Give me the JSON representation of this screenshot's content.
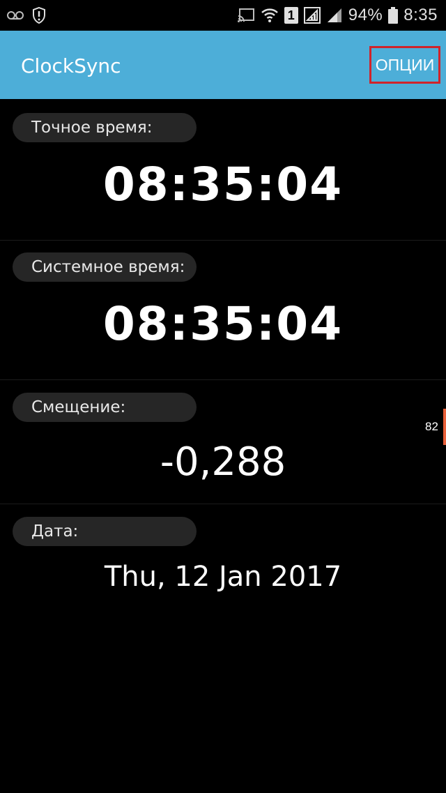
{
  "status_bar": {
    "battery_percent": "94%",
    "time": "8:35",
    "sim_slot": "1",
    "icons": [
      "voicemail-icon",
      "shield-alert-icon",
      "cast-icon",
      "wifi-icon",
      "sim-signal-icon",
      "signal-icon",
      "battery-icon"
    ]
  },
  "app_bar": {
    "title": "ClockSync",
    "options_label": "ОПЦИИ",
    "color": "#4daed8",
    "highlight_color": "#d0232a"
  },
  "sections": {
    "exact_time": {
      "label": "Точное время:",
      "value": "08:35:04"
    },
    "system_time": {
      "label": "Системное время:",
      "value": "08:35:04"
    },
    "offset": {
      "label": "Смещение:",
      "value": "-0,288"
    },
    "date": {
      "label": "Дата:",
      "value": "Thu, 12 Jan 2017"
    }
  },
  "side_indicator": {
    "number": "82",
    "color": "#e8603a"
  }
}
